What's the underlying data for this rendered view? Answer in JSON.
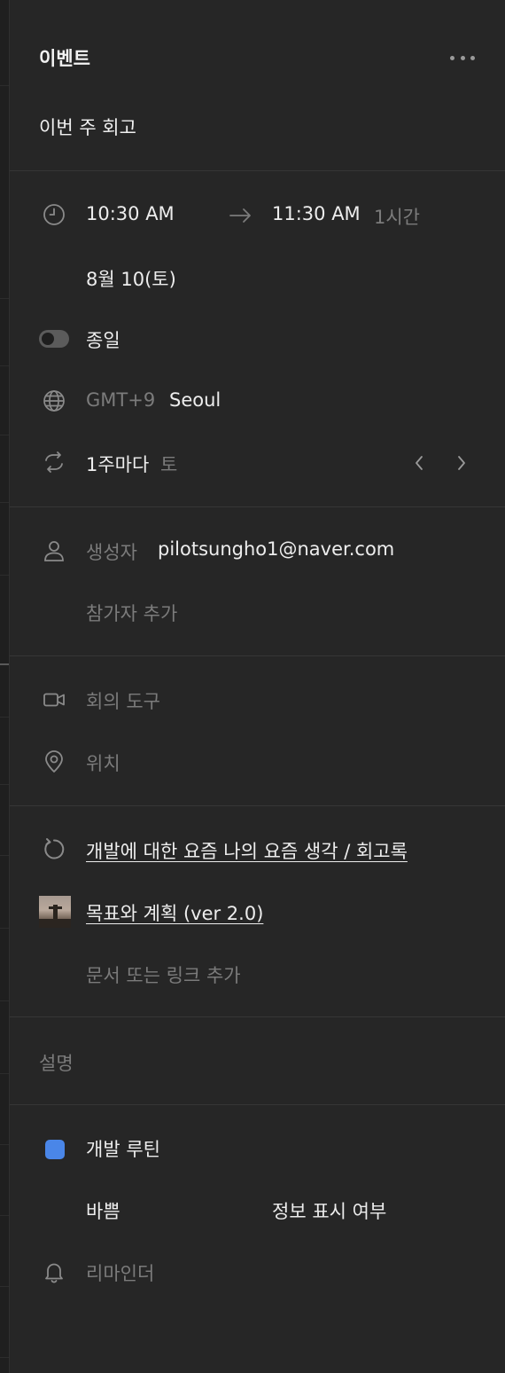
{
  "header": {
    "title": "이벤트",
    "event_name": "이번 주 회고"
  },
  "time": {
    "start": "10:30 AM",
    "end": "11:30 AM",
    "duration": "1시간",
    "date": "8월 10(토)",
    "all_day_label": "종일",
    "all_day_on": false,
    "timezone_offset": "GMT+9",
    "timezone_city": "Seoul",
    "repeat": "1주마다",
    "repeat_day": "토"
  },
  "people": {
    "creator_label": "생성자",
    "creator_email": "pilotsungho1@naver.com",
    "add_attendee": "참가자 추가"
  },
  "meeting": {
    "tool_label": "회의 도구",
    "location_label": "위치"
  },
  "documents": {
    "items": [
      {
        "title": "개발에 대한 요즘 나의 요즘 생각 / 회고록",
        "icon": "refresh-page-icon"
      },
      {
        "title": "목표와 계획 (ver 2.0)",
        "icon": "page-cover-thumbnail"
      }
    ],
    "add_label": "문서 또는 링크 추가"
  },
  "description": {
    "label": "설명"
  },
  "calendar": {
    "name": "개발 루틴",
    "color": "#4a86e8",
    "busy": "바쁨",
    "visibility": "정보 표시 여부",
    "reminder_label": "리마인더"
  }
}
